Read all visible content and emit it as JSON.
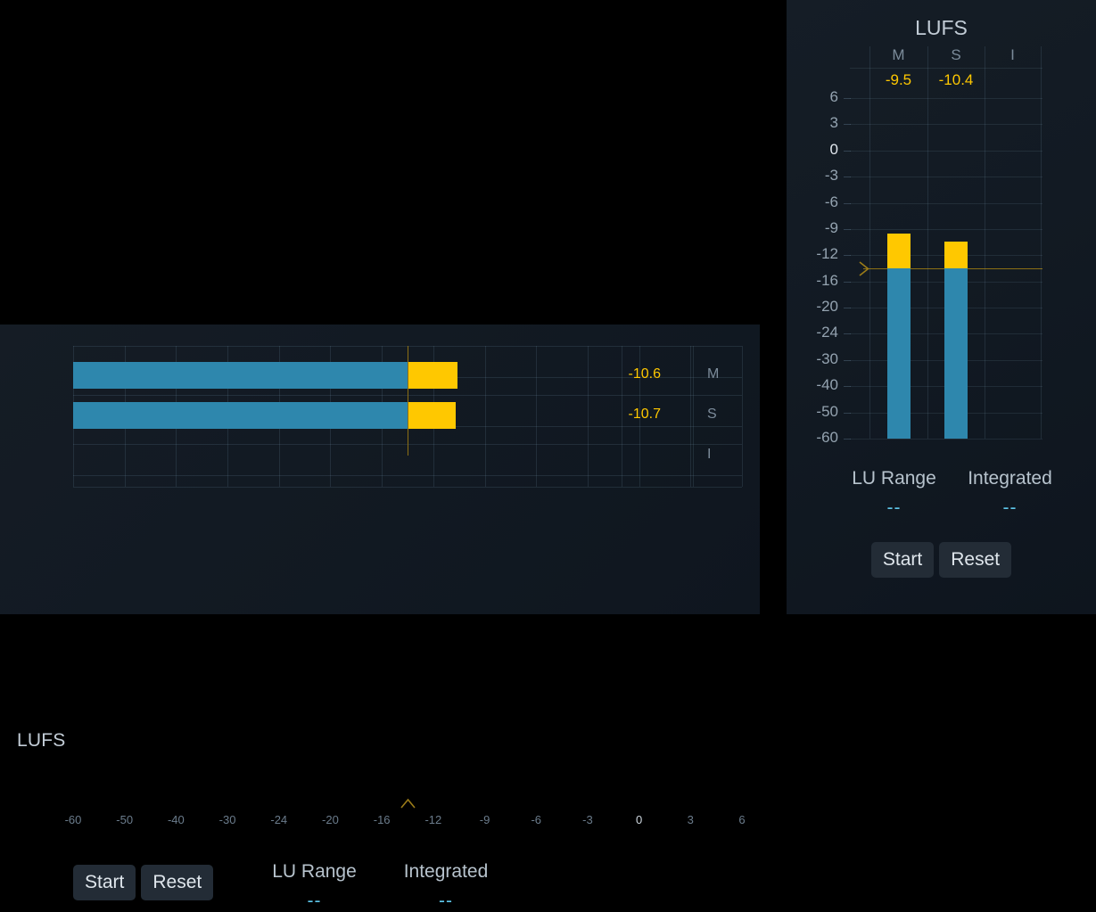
{
  "left_panel": {
    "unit_label": "LUFS",
    "rows": [
      {
        "key": "M",
        "value": "-10.6",
        "bar_lufs": -10.6
      },
      {
        "key": "S",
        "value": "-10.7",
        "bar_lufs": -10.7
      },
      {
        "key": "I",
        "value": ""
      }
    ],
    "axis_ticks": [
      "-60",
      "-50",
      "-40",
      "-30",
      "-24",
      "-20",
      "-16",
      "-12",
      "-9",
      "-6",
      "-3",
      "0",
      "3",
      "6"
    ],
    "axis_zero_tick": "0",
    "target_lufs": "-14",
    "stats": [
      {
        "title": "LU Range",
        "value": "--"
      },
      {
        "title": "Integrated",
        "value": "--"
      }
    ],
    "buttons": [
      {
        "label": "Start",
        "name": "start-button"
      },
      {
        "label": "Reset",
        "name": "reset-button"
      }
    ]
  },
  "right_panel": {
    "title": "LUFS",
    "columns": [
      {
        "head": "M",
        "value": "-9.5",
        "bar_lufs": -9.5
      },
      {
        "head": "S",
        "value": "-10.4",
        "bar_lufs": -10.4
      },
      {
        "head": "I",
        "value": "",
        "bar_lufs": null
      }
    ],
    "axis_ticks": [
      "6",
      "3",
      "0",
      "-3",
      "-6",
      "-9",
      "-12",
      "-16",
      "-20",
      "-24",
      "-30",
      "-40",
      "-50",
      "-60"
    ],
    "axis_zero_tick": "0",
    "target_lufs": "-14",
    "stats": [
      {
        "title": "LU Range",
        "value": "--"
      },
      {
        "title": "Integrated",
        "value": "--"
      }
    ],
    "buttons": [
      {
        "label": "Start",
        "name": "start-button"
      },
      {
        "label": "Reset",
        "name": "reset-button"
      }
    ]
  },
  "colors": {
    "bar_blue": "#2e87ad",
    "bar_gold": "#ffc800",
    "value_gold": "#ffc800",
    "stat_value_blue": "#5ec6ea",
    "panel_bg": "#121a23",
    "target_line": "#8c6f14"
  },
  "chart_data": [
    {
      "type": "bar",
      "orientation": "horizontal",
      "title": "LUFS",
      "categories": [
        "M",
        "S",
        "I"
      ],
      "values": [
        -10.6,
        -10.7,
        null
      ],
      "xlabel": "LUFS",
      "ylabel": "",
      "xlim": [
        -60,
        8
      ],
      "tick_labels": [
        "-60",
        "-50",
        "-40",
        "-30",
        "-24",
        "-20",
        "-16",
        "-12",
        "-9",
        "-6",
        "-3",
        "0",
        "3",
        "6"
      ],
      "target_line": -14,
      "grid": true,
      "legend": "none"
    },
    {
      "type": "bar",
      "orientation": "vertical",
      "title": "LUFS",
      "categories": [
        "M",
        "S",
        "I"
      ],
      "values": [
        -9.5,
        -10.4,
        null
      ],
      "xlabel": "",
      "ylabel": "LUFS",
      "ylim": [
        -60,
        8
      ],
      "tick_labels": [
        "6",
        "3",
        "0",
        "-3",
        "-6",
        "-9",
        "-12",
        "-16",
        "-20",
        "-24",
        "-30",
        "-40",
        "-50",
        "-60"
      ],
      "target_line": -14,
      "grid": true,
      "legend": "none"
    }
  ]
}
